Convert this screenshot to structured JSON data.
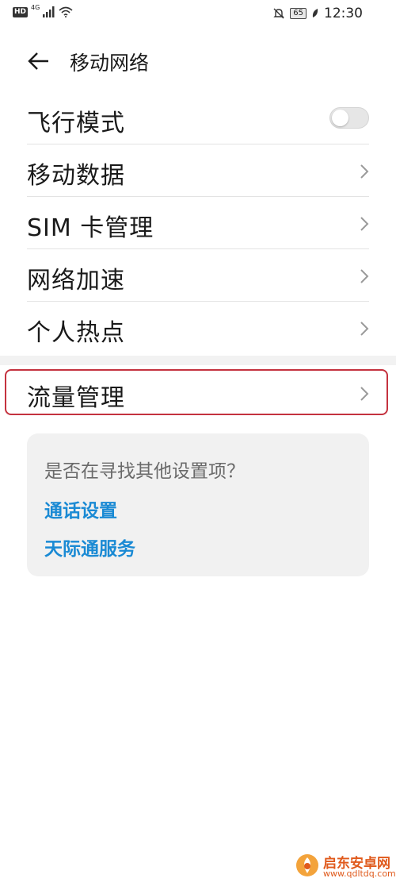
{
  "status_bar": {
    "hd": "HD",
    "network_type": "4G",
    "battery": "65",
    "time": "12:30"
  },
  "header": {
    "title": "移动网络"
  },
  "settings": {
    "items": [
      {
        "label": "飞行模式",
        "control": "toggle",
        "toggle_state": "off"
      },
      {
        "label": "移动数据",
        "control": "chevron"
      },
      {
        "label": "SIM 卡管理",
        "control": "chevron"
      },
      {
        "label": "网络加速",
        "control": "chevron"
      },
      {
        "label": "个人热点",
        "control": "chevron"
      }
    ],
    "traffic": {
      "label": "流量管理",
      "control": "chevron",
      "highlighted": true
    }
  },
  "suggestions": {
    "question": "是否在寻找其他设置项？",
    "links": [
      "通话设置",
      "天际通服务"
    ]
  },
  "watermark": {
    "title": "启东安卓网",
    "url": "www.qdltdq.com"
  },
  "colors": {
    "link": "#1a8ad4",
    "highlight_border": "#c4323f",
    "watermark": "#e05a1c"
  }
}
